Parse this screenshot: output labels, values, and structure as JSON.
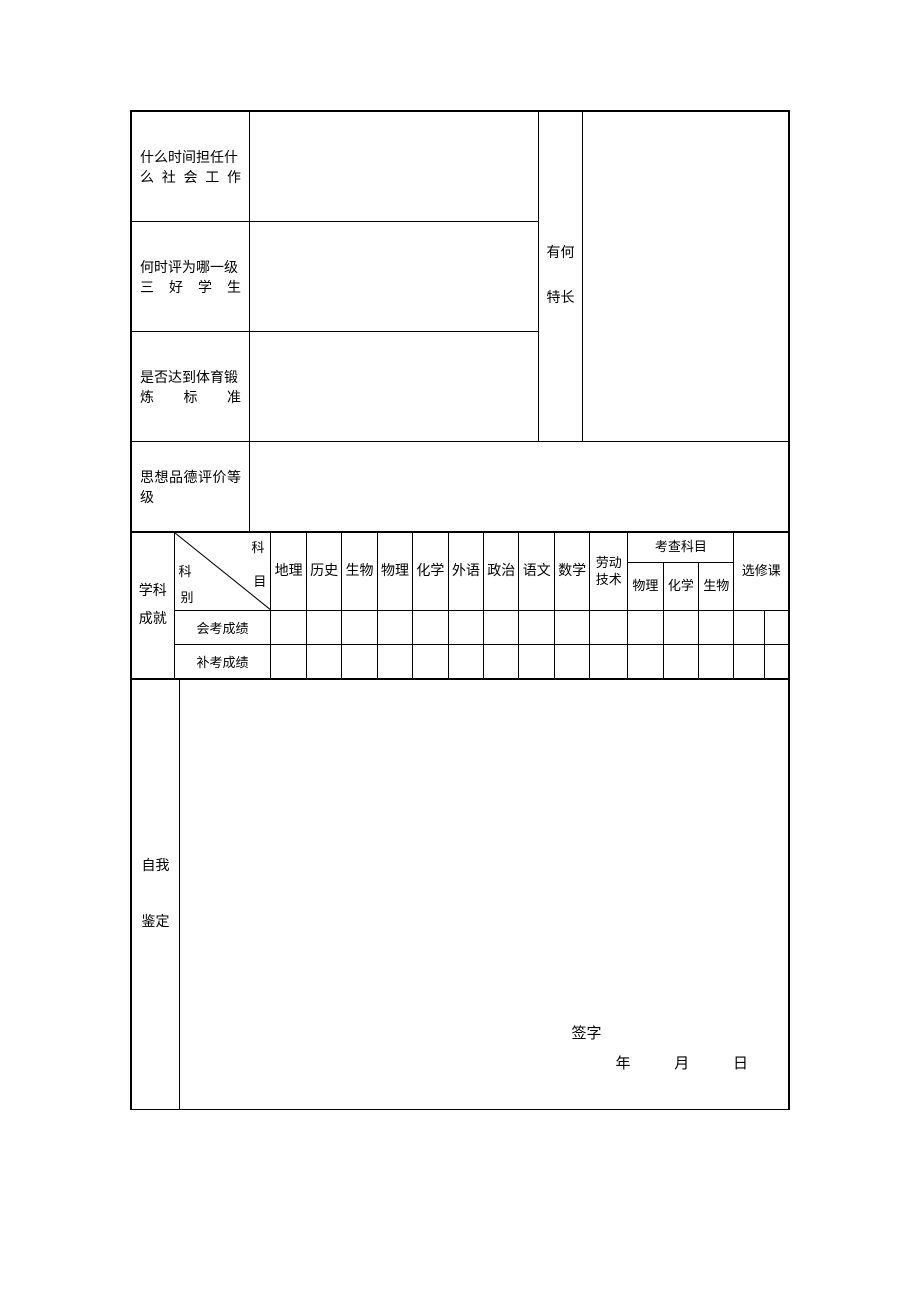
{
  "rows": {
    "r1_label": "什么时间担任什么社会工作",
    "r2_label": "何时评为哪一级三好学生",
    "r3_label": "是否达到体育锻炼标准",
    "r4_label": "思想品德评价等级",
    "side_label": "有何特长"
  },
  "grades": {
    "group_label": "学科成就",
    "diag_top": "科",
    "diag_right": "目",
    "diag_left": "科",
    "diag_bottom": "别",
    "subjects": [
      "地理",
      "历史",
      "生物",
      "物理",
      "化学",
      "外语",
      "政治",
      "语文",
      "数学"
    ],
    "labor": "劳动技术",
    "exam_group": "考查科目",
    "exam_sub": [
      "物理",
      "化学",
      "生物"
    ],
    "elective": "选修课",
    "row_exam": "会考成绩",
    "row_retake": "补考成绩"
  },
  "self": {
    "label": "自我鉴定",
    "sign": "签字",
    "year": "年",
    "month": "月",
    "day": "日"
  }
}
